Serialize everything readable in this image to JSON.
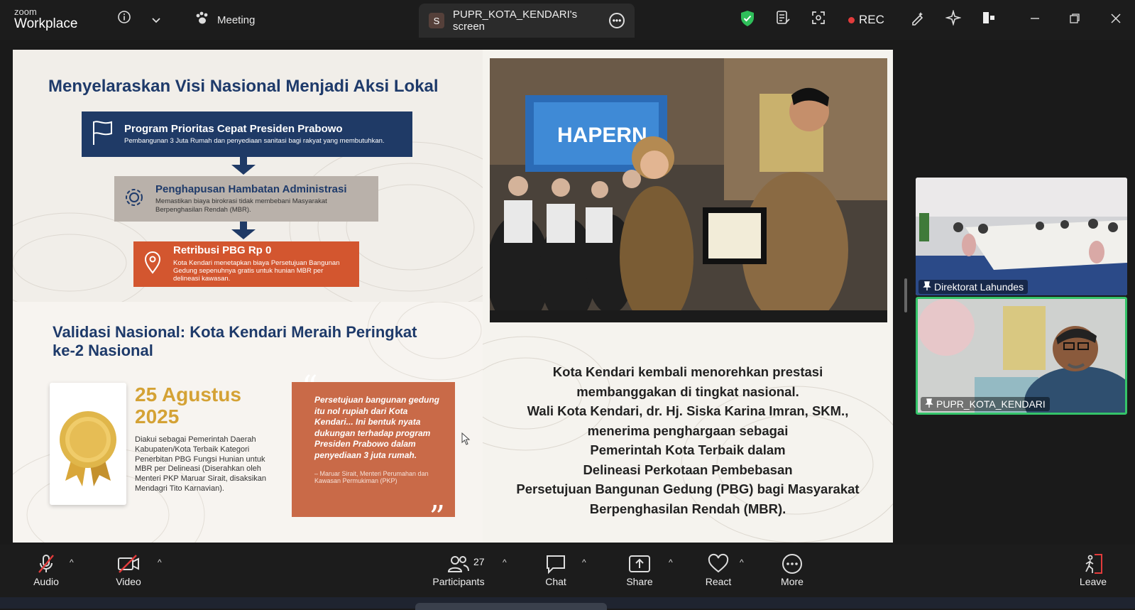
{
  "app": {
    "brand_top": "zoom",
    "brand_bottom": "Workplace"
  },
  "topbar": {
    "meeting_label": "Meeting",
    "screen_tab_initial": "S",
    "screen_tab_label": "PUPR_KOTA_KENDARI's screen",
    "rec_label": "REC"
  },
  "slide": {
    "title": "Menyelaraskan Visi Nasional Menjadi Aksi Lokal",
    "steps": [
      {
        "title": "Program Prioritas Cepat Presiden Prabowo",
        "subtitle": "Pembangunan 3 Juta Rumah dan penyediaan sanitasi bagi rakyat yang membutuhkan."
      },
      {
        "title": "Penghapusan Hambatan Administrasi",
        "subtitle": "Memastikan biaya birokrasi tidak membebani Masyarakat Berpenghasilan Rendah (MBR)."
      },
      {
        "title": "Retribusi PBG Rp 0",
        "subtitle": "Kota Kendari menetapkan biaya Persetujuan Bangunan Gedung sepenuhnya gratis untuk hunian MBR per delineasi kawasan."
      }
    ],
    "section_title": "Validasi Nasional: Kota Kendari Meraih Peringkat ke-2 Nasional",
    "date": "25 Agustus 2025",
    "description": "Diakui sebagai Pemerintah Daerah Kabupaten/Kota Terbaik Kategori Penerbitan PBG Fungsi Hunian untuk MBR per Delineasi (Diserahkan oleh Menteri PKP Maruar Sirait, disaksikan Mendagri Tito Karnavian).",
    "quote": "Persetujuan bangunan gedung itu nol rupiah dari Kota Kendari... Ini bentuk nyata dukungan terhadap program Presiden Prabowo dalam penyediaan 3 juta rumah.",
    "quote_by": "– Maruar Sirait, Menteri Perumahan dan Kawasan Permukiman (PKP)",
    "screen_text": "HAPERN",
    "right_text": [
      "Kota Kendari kembali menorehkan prestasi",
      "membanggakan di tingkat nasional.",
      "Wali Kota Kendari, dr. Hj. Siska Karina Imran, SKM.,",
      "menerima penghargaan sebagai",
      "Pemerintah Kota Terbaik dalam",
      "Delineasi Perkotaan Pembebasan",
      "Persetujuan Bangunan Gedung (PBG) bagi Masyarakat",
      "Berpenghasilan Rendah (MBR)."
    ]
  },
  "participants": [
    {
      "name": "Direktorat Lahundes",
      "active": false
    },
    {
      "name": "PUPR_KOTA_KENDARI",
      "active": true
    }
  ],
  "toolbar": {
    "audio": "Audio",
    "video": "Video",
    "participants": "Participants",
    "participants_count": "27",
    "chat": "Chat",
    "share": "Share",
    "react": "React",
    "more": "More",
    "leave": "Leave"
  },
  "colors": {
    "navy": "#1f3a66",
    "orange": "#d3562f",
    "gold": "#d4a235",
    "active_speaker": "#35c46a",
    "rec": "#e23b3b"
  }
}
